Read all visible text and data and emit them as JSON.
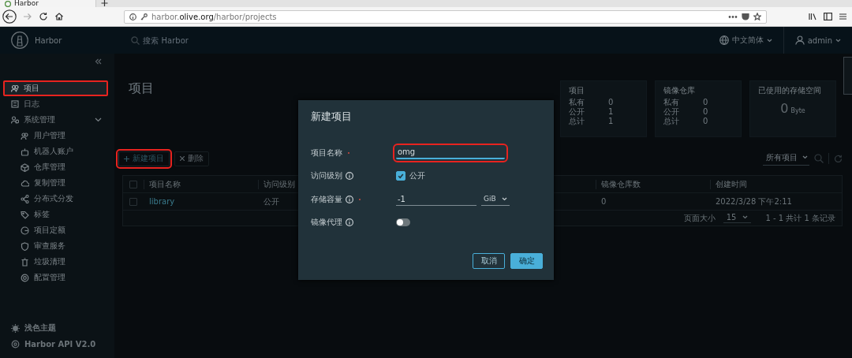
{
  "browser": {
    "tab_title": "Harbor",
    "url": "harbor.**olive.org**/harbor/projects"
  },
  "header": {
    "app_name": "Harbor",
    "search_placeholder": "搜索 Harbor",
    "language": "中文简体",
    "user": "admin"
  },
  "sidebar": {
    "items": [
      {
        "label": "项目",
        "selected": true,
        "highlighted": true
      },
      {
        "label": "日志",
        "selected": false,
        "highlighted": false
      },
      {
        "label": "系统管理",
        "selected": false,
        "highlighted": false,
        "expanded": true,
        "children": [
          {
            "label": "用户管理",
            "selected": false
          },
          {
            "label": "机器人账户",
            "selected": false
          },
          {
            "label": "仓库管理",
            "selected": false
          },
          {
            "label": "复制管理",
            "selected": false
          },
          {
            "label": "分布式分发",
            "selected": false
          },
          {
            "label": "标签",
            "selected": false
          },
          {
            "label": "项目定额",
            "selected": false
          },
          {
            "label": "审查服务",
            "selected": false
          },
          {
            "label": "垃圾清理",
            "selected": false
          },
          {
            "label": "配置管理",
            "selected": false
          }
        ]
      }
    ],
    "footer": [
      {
        "label": "浅色主题"
      },
      {
        "label": "Harbor API V2.0"
      }
    ]
  },
  "page": {
    "title": "项目"
  },
  "stats": [
    {
      "title": "项目",
      "rows": [
        {
          "label": "私有",
          "value": "0"
        },
        {
          "label": "公开",
          "value": "1"
        },
        {
          "label": "总计",
          "value": "1"
        }
      ]
    },
    {
      "title": "镜像仓库",
      "rows": [
        {
          "label": "私有",
          "value": "0"
        },
        {
          "label": "公开",
          "value": "0"
        },
        {
          "label": "总计",
          "value": "0"
        }
      ]
    }
  ],
  "storage": {
    "title": "已使用的存储空间",
    "value": "0",
    "unit": "Byte"
  },
  "toolbar": {
    "buttons": [
      {
        "label": "新建项目",
        "kind": "add",
        "disabled": false,
        "highlighted": true
      },
      {
        "label": "删除",
        "kind": "delete",
        "disabled": true,
        "highlighted": false
      }
    ],
    "filter": "所有项目"
  },
  "table": {
    "select_all_checked": false,
    "columns": [
      "项目名称",
      "访问级别",
      "镜像仓库数",
      "创建时间"
    ],
    "rows": [
      {
        "checked": false,
        "cells": [
          "library",
          "公开",
          "0",
          "2022/3/28 下午2:11"
        ]
      }
    ],
    "page_size_label": "页面大小",
    "page_size": "15",
    "summary": "1 - 1 共计 1 条记录"
  },
  "dialog": {
    "title": "新建项目",
    "fields": [
      {
        "kind": "text",
        "label": "项目名称",
        "required": true,
        "info": false,
        "value": "omg",
        "highlighted": true
      },
      {
        "kind": "checkbox",
        "label": "访问级别",
        "required": false,
        "info": true,
        "checked": true,
        "option": "公开"
      },
      {
        "kind": "quota",
        "label": "存储容量",
        "required": true,
        "info": true,
        "value": "-1",
        "unit": "GiB"
      },
      {
        "kind": "toggle",
        "label": "镜像代理",
        "required": false,
        "info": true,
        "on": false
      }
    ],
    "buttons": [
      {
        "label": "取消",
        "kind": "secondary"
      },
      {
        "label": "确定",
        "kind": "primary"
      }
    ]
  }
}
